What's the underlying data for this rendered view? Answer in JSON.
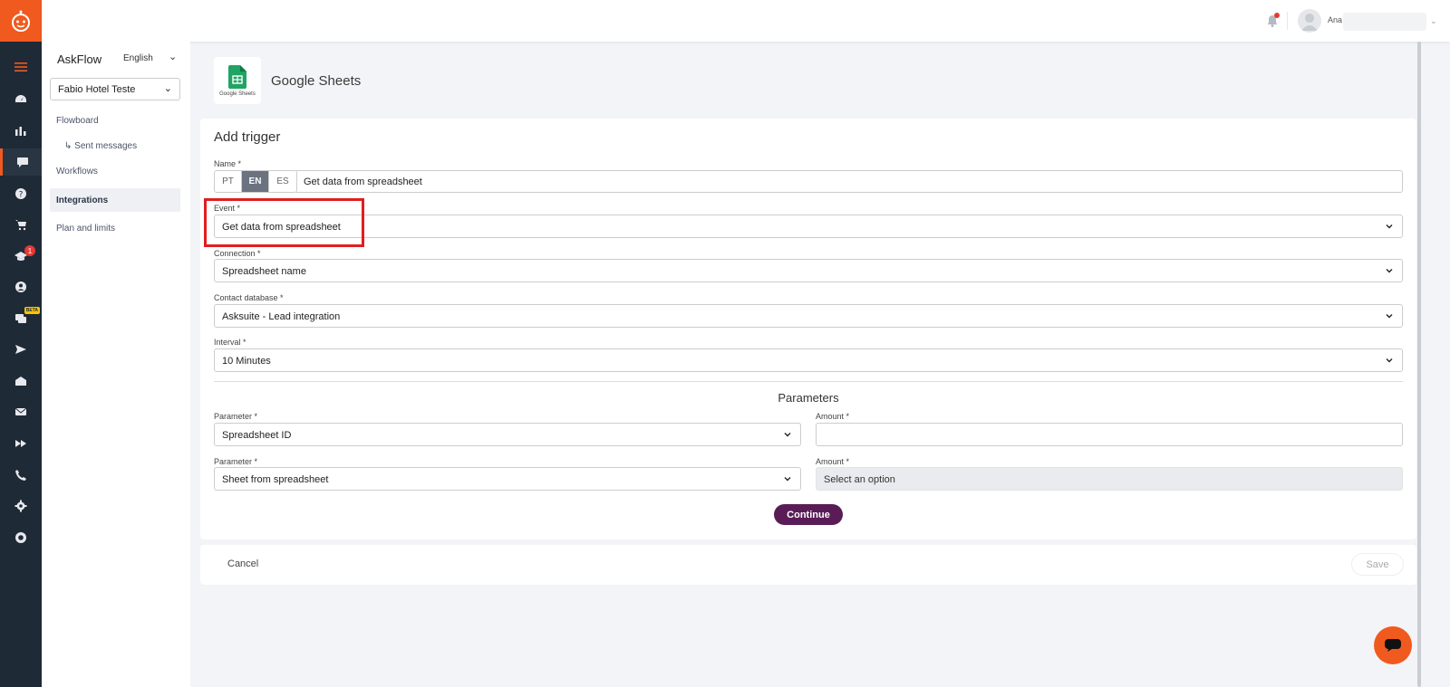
{
  "topbar": {
    "user_name": "Ana"
  },
  "sidebar": {
    "brand": "AskFlow",
    "language": "English",
    "hotel": "Fabio Hotel Teste",
    "items": [
      {
        "label": "Flowboard"
      },
      {
        "label": "↳ Sent messages"
      },
      {
        "label": "Workflows"
      },
      {
        "label": "Integrations"
      },
      {
        "label": "Plan and limits"
      }
    ]
  },
  "rail": {
    "notification_badge": "1",
    "beta_label": "BETA"
  },
  "app": {
    "title": "Google Sheets",
    "icon_caption": "Google Sheets"
  },
  "form": {
    "heading": "Add trigger",
    "name_label": "Name *",
    "languages": [
      "PT",
      "EN",
      "ES"
    ],
    "selected_language": "EN",
    "name_value": "Get data from spreadsheet",
    "event_label": "Event *",
    "event_value": "Get data from spreadsheet",
    "connection_label": "Connection *",
    "connection_value": "Spreadsheet name",
    "contact_db_label": "Contact database *",
    "contact_db_value": "Asksuite - Lead integration",
    "interval_label": "Interval *",
    "interval_value": "10 Minutes",
    "parameters_title": "Parameters",
    "param1_label": "Parameter *",
    "param1_value": "Spreadsheet ID",
    "amount1_label": "Amount *",
    "amount1_value": "",
    "param2_label": "Parameter *",
    "param2_value": "Sheet from spreadsheet",
    "amount2_label": "Amount *",
    "amount2_placeholder": "Select an option",
    "continue_label": "Continue"
  },
  "footer": {
    "cancel_label": "Cancel",
    "save_label": "Save"
  },
  "colors": {
    "brand_orange": "#f05a1f",
    "rail_dark": "#1f2a37",
    "primary_purple": "#5a1c57",
    "highlight_red": "#e01e1e"
  }
}
